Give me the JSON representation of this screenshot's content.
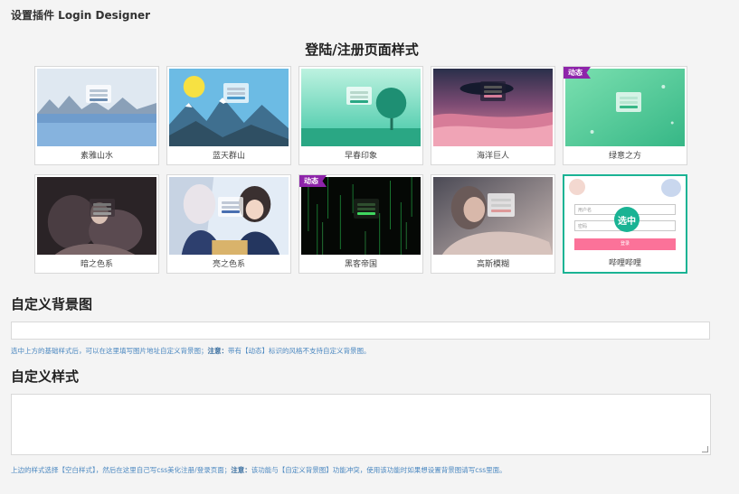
{
  "page": {
    "title": "设置插件 Login Designer",
    "section_title": "登陆/注册页面样式"
  },
  "styles": [
    {
      "label": "素雅山水",
      "badge": "",
      "selected": false,
      "theme": "mountain-lake"
    },
    {
      "label": "蓝天群山",
      "badge": "",
      "selected": false,
      "theme": "sun-mountains"
    },
    {
      "label": "早春印象",
      "badge": "",
      "selected": false,
      "theme": "spring-tree"
    },
    {
      "label": "海洋巨人",
      "badge": "",
      "selected": false,
      "theme": "ocean-giant"
    },
    {
      "label": "绿意之方",
      "badge": "动态",
      "selected": false,
      "theme": "green"
    },
    {
      "label": "暗之色系",
      "badge": "",
      "selected": false,
      "theme": "dark-anime"
    },
    {
      "label": "亮之色系",
      "badge": "",
      "selected": false,
      "theme": "bright-anime"
    },
    {
      "label": "黑客帝国",
      "badge": "动态",
      "selected": false,
      "theme": "matrix"
    },
    {
      "label": "高斯模糊",
      "badge": "",
      "selected": false,
      "theme": "blur"
    },
    {
      "label": "哔哩哔哩",
      "badge": "",
      "selected": true,
      "theme": "bilibili"
    }
  ],
  "selected_badge": "选中",
  "bilibili_preview": {
    "username_placeholder": "用户名",
    "password_placeholder": "密码",
    "login_button": "登录"
  },
  "custom_bg": {
    "heading": "自定义背景图",
    "value": "",
    "hint_prefix": "选中上方的基础样式后，可以在这里填写图片地址自定义背景图；",
    "hint_bold": "注意：",
    "hint_suffix": "带有【动态】标识的风格不支持自定义背景图。"
  },
  "custom_css": {
    "heading": "自定义样式",
    "value": "",
    "hint_prefix": "上边的样式选择【空白样式】，然后在这里自己写css美化注册/登录页面；",
    "hint_bold": "注意：",
    "hint_suffix": "该功能与【自定义背景图】功能冲突，使用该功能时如果想设置背景图请写css里面。"
  },
  "colors": {
    "accent": "#1ab394",
    "badge": "#8e24aa",
    "hint": "#4a87c0",
    "bilibili_pink": "#fb7299"
  }
}
